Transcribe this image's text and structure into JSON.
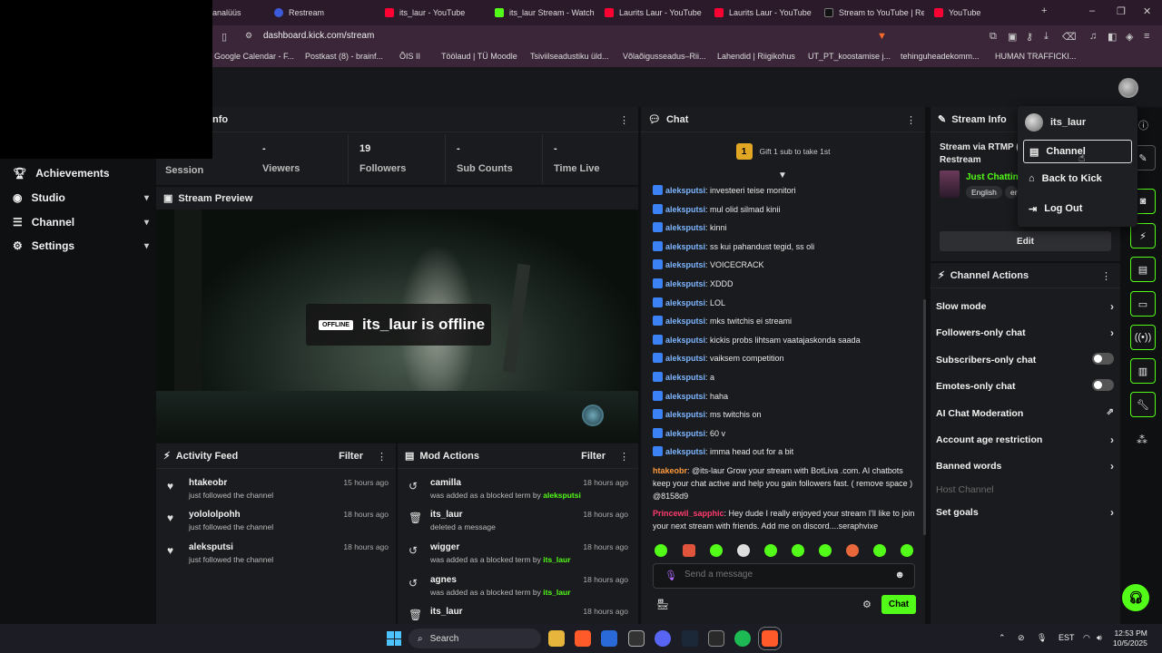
{
  "browser": {
    "tabs": [
      {
        "label": "analüüs",
        "fav": "tab"
      },
      {
        "label": "Restream",
        "fav": "rs"
      },
      {
        "label": "its_laur - YouTube",
        "fav": "yt"
      },
      {
        "label": "its_laur Stream - Watch L",
        "fav": "kick"
      },
      {
        "label": "Laurits Laur - YouTube",
        "fav": "yt"
      },
      {
        "label": "Laurits Laur - YouTube",
        "fav": "yt"
      },
      {
        "label": "Stream to YouTube | Res",
        "fav": "r"
      },
      {
        "label": "YouTube",
        "fav": "yt"
      }
    ],
    "new_tab": "+",
    "url": "dashboard.kick.com/stream",
    "bookmarks": [
      "Google Calendar - F...",
      "Postkast (8) - brainf...",
      "ÕIS II",
      "Töölaud | TÜ Moodle",
      "Tsiviilseadustiku üld...",
      "Võlaõigusseadus–Rii...",
      "Lahendid | Riigikohus",
      "UT_PT_koostamise j...",
      "tehinguheadekomm...",
      "HUMAN TRAFFICKI..."
    ]
  },
  "sidebar": {
    "items": [
      {
        "label": "Achievements",
        "icon": "trophy-icon",
        "chevron": false
      },
      {
        "label": "Studio",
        "icon": "studio-icon",
        "chevron": true
      },
      {
        "label": "Channel",
        "icon": "channel-icon",
        "chevron": true
      },
      {
        "label": "Settings",
        "icon": "gear-icon",
        "chevron": true
      }
    ]
  },
  "session_panel": {
    "title_fragment": "nfo",
    "session_label": "Session",
    "stats": [
      {
        "value": "-",
        "label": "Viewers"
      },
      {
        "value": "19",
        "label": "Followers"
      },
      {
        "value": "-",
        "label": "Sub Counts"
      },
      {
        "value": "-",
        "label": "Time Live"
      }
    ]
  },
  "preview": {
    "title": "Stream Preview",
    "offline_tag": "OFFLINE",
    "offline_text": "its_laur is offline"
  },
  "activity": {
    "title": "Activity Feed",
    "filter": "Filter",
    "items": [
      {
        "name": "htakeobr",
        "sub": "just followed the channel",
        "time": "15 hours ago"
      },
      {
        "name": "yolololpohh",
        "sub": "just followed the channel",
        "time": "18 hours ago"
      },
      {
        "name": "aleksputsi",
        "sub": "just followed the channel",
        "time": "18 hours ago"
      }
    ]
  },
  "mod_actions": {
    "title": "Mod Actions",
    "filter": "Filter",
    "items": [
      {
        "name": "camilla",
        "sub": "was added as a blocked term by ",
        "by": "aleksputsi",
        "time": "18 hours ago",
        "icon": "undo"
      },
      {
        "name": "its_laur",
        "sub": "deleted a message",
        "by": "",
        "time": "18 hours ago",
        "icon": "trash"
      },
      {
        "name": "wigger",
        "sub": "was added as a blocked term by ",
        "by": "its_laur",
        "time": "18 hours ago",
        "icon": "undo"
      },
      {
        "name": "agnes",
        "sub": "was added as a blocked term by ",
        "by": "its_laur",
        "time": "18 hours ago",
        "icon": "undo"
      },
      {
        "name": "its_laur",
        "sub": "",
        "by": "",
        "time": "18 hours ago",
        "icon": "trash"
      }
    ]
  },
  "chat": {
    "title": "Chat",
    "gift_badge": "1",
    "gift_text": "Gift 1 sub to take 1st",
    "messages": [
      {
        "user": "aleksputsi",
        "text": ": investeeri teise monitori",
        "style": "blue",
        "badge": true
      },
      {
        "user": "aleksputsi",
        "text": ": mul olid silmad kinii",
        "style": "blue",
        "badge": true
      },
      {
        "user": "aleksputsi",
        "text": ": kinni",
        "style": "blue",
        "badge": true
      },
      {
        "user": "aleksputsi",
        "text": ": ss kui pahandust tegid, ss oli",
        "style": "blue",
        "badge": true
      },
      {
        "user": "aleksputsi",
        "text": ": VOICECRACK",
        "style": "blue",
        "badge": true
      },
      {
        "user": "aleksputsi",
        "text": ": XDDD",
        "style": "blue",
        "badge": true
      },
      {
        "user": "aleksputsi",
        "text": ": LOL",
        "style": "blue",
        "badge": true
      },
      {
        "user": "aleksputsi",
        "text": ": mks twitchis ei streami",
        "style": "blue",
        "badge": true
      },
      {
        "user": "aleksputsi",
        "text": ": kickis probs lihtsam vaatajaskonda saada",
        "style": "blue",
        "badge": true
      },
      {
        "user": "aleksputsi",
        "text": ": vaiksem competition",
        "style": "blue",
        "badge": true
      },
      {
        "user": "aleksputsi",
        "text": ": a",
        "style": "blue",
        "badge": true
      },
      {
        "user": "aleksputsi",
        "text": ": haha",
        "style": "blue",
        "badge": true
      },
      {
        "user": "aleksputsi",
        "text": ": ms twitchis on",
        "style": "blue",
        "badge": true
      },
      {
        "user": "aleksputsi",
        "text": ": 60 v",
        "style": "blue",
        "badge": true
      },
      {
        "user": "aleksputsi",
        "text": ": imma head out for a bit",
        "style": "blue",
        "badge": true
      },
      {
        "user": "htakeobr",
        "text": ": @its-laur Grow your stream with BotLiva .com. AI chatbots keep your chat active and help you gain followers fast. ( remove space ) @8158d9",
        "style": "orange",
        "badge": false
      },
      {
        "user": "Princewil_sapphic",
        "text": ": Hey dude I really enjoyed your stream I'll like to join your next stream with friends. Add me on discord....seraphvixe",
        "style": "red",
        "badge": false
      }
    ],
    "input_placeholder": "Send a message",
    "send_label": "Chat"
  },
  "stream_info": {
    "title": "Stream Info",
    "stream_via": "Stream via RTMP (",
    "restream": "Restream",
    "category": "Just Chatting",
    "tags": [
      "English",
      "er"
    ],
    "edit_label": "Edit"
  },
  "channel_actions": {
    "title": "Channel Actions",
    "rows": [
      {
        "label": "Slow mode",
        "control": "arrow"
      },
      {
        "label": "Followers-only chat",
        "control": "arrow"
      },
      {
        "label": "Subscribers-only chat",
        "control": "toggle"
      },
      {
        "label": "Emotes-only chat",
        "control": "toggle"
      },
      {
        "label": "AI Chat Moderation",
        "control": "external"
      },
      {
        "label": "Account age restriction",
        "control": "arrow"
      },
      {
        "label": "Banned words",
        "control": "arrow"
      },
      {
        "label": "Host Channel",
        "control": "none"
      },
      {
        "label": "Set goals",
        "control": "arrow"
      }
    ]
  },
  "user_menu": {
    "username": "its_laur",
    "items": [
      {
        "label": "Channel",
        "icon": "channel-icon",
        "active": true
      },
      {
        "label": "Back to Kick",
        "icon": "home-icon",
        "active": false
      },
      {
        "label": "Log Out",
        "icon": "logout-icon",
        "active": false
      }
    ]
  },
  "colors": {
    "accent": "#53fc18",
    "panel": "#1a1b1e",
    "tab_bar": "#2b1a2a"
  },
  "taskbar": {
    "search": "Search",
    "tray_lang": "EST",
    "time": "12:53 PM",
    "date": "10/5/2025"
  }
}
